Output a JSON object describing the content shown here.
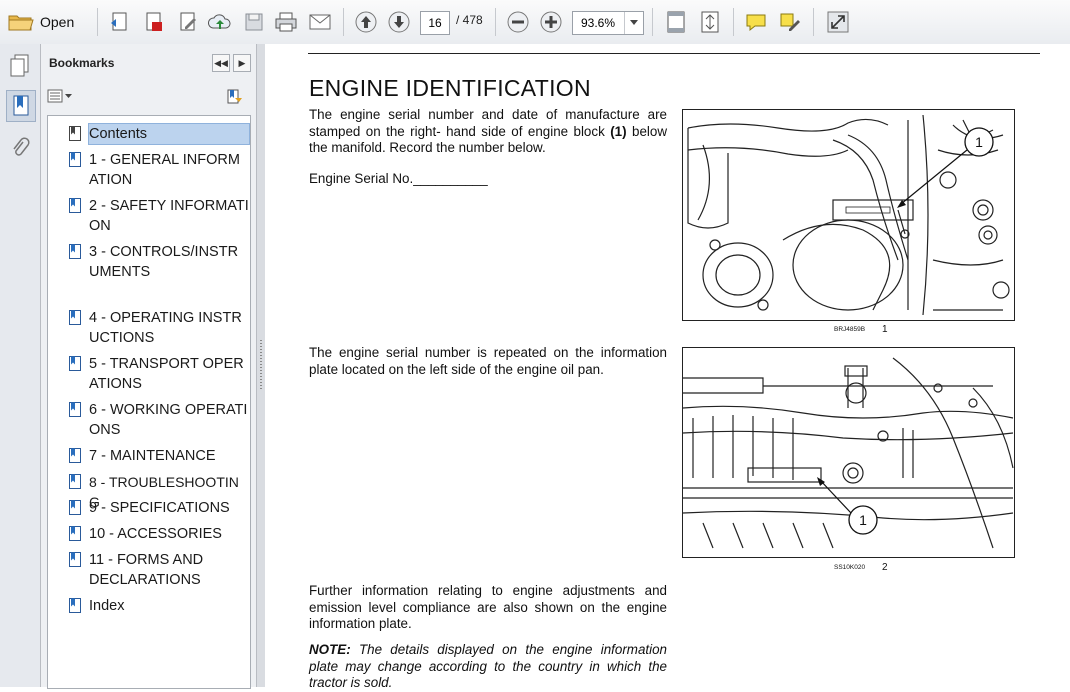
{
  "toolbar": {
    "open_label": "Open",
    "current_page": "16",
    "page_total": "/ 478",
    "zoom": "93.6%"
  },
  "bookmarks": {
    "title": "Bookmarks",
    "items": [
      {
        "label": "Contents"
      },
      {
        "label": "1 - GENERAL INFORMATION"
      },
      {
        "label": "2 - SAFETY INFORMATION"
      },
      {
        "label": "3 - CONTROLS/INSTRUMENTS"
      },
      {
        "label": "4 - OPERATING INSTRUCTIONS"
      },
      {
        "label": "5 - TRANSPORT OPERATIONS"
      },
      {
        "label": "6 - WORKING OPERATIONS"
      },
      {
        "label": "7 - MAINTENANCE"
      },
      {
        "label": "8 - TROUBLESHOOTING"
      },
      {
        "label": "9 - SPECIFICATIONS"
      },
      {
        "label": "10 - ACCESSORIES"
      },
      {
        "label": "11 - FORMS AND DECLARATIONS"
      },
      {
        "label": "Index"
      }
    ]
  },
  "document": {
    "title": "ENGINE IDENTIFICATION",
    "para1_a": "The engine serial number and date of manufacture are stamped on the right- hand side of engine block ",
    "para1_b": "(1)",
    "para1_c": " below the manifold.  Record the number below.",
    "serial_label": "Engine Serial No.__________",
    "para2": "The engine serial number is repeated on the information plate located on the left side of the engine oil pan.",
    "para3": "Further information relating to engine adjustments and emission level compliance are also shown on the engine information plate.",
    "note_label": "NOTE:",
    "note_text": " The details displayed on the engine information plate may change according to the country in which the tractor is sold.",
    "fig1_code": "BRJ4859B",
    "fig1_num": "1",
    "fig1_callout": "1",
    "fig2_code": "SS10K020",
    "fig2_num": "2",
    "fig2_callout": "1"
  }
}
